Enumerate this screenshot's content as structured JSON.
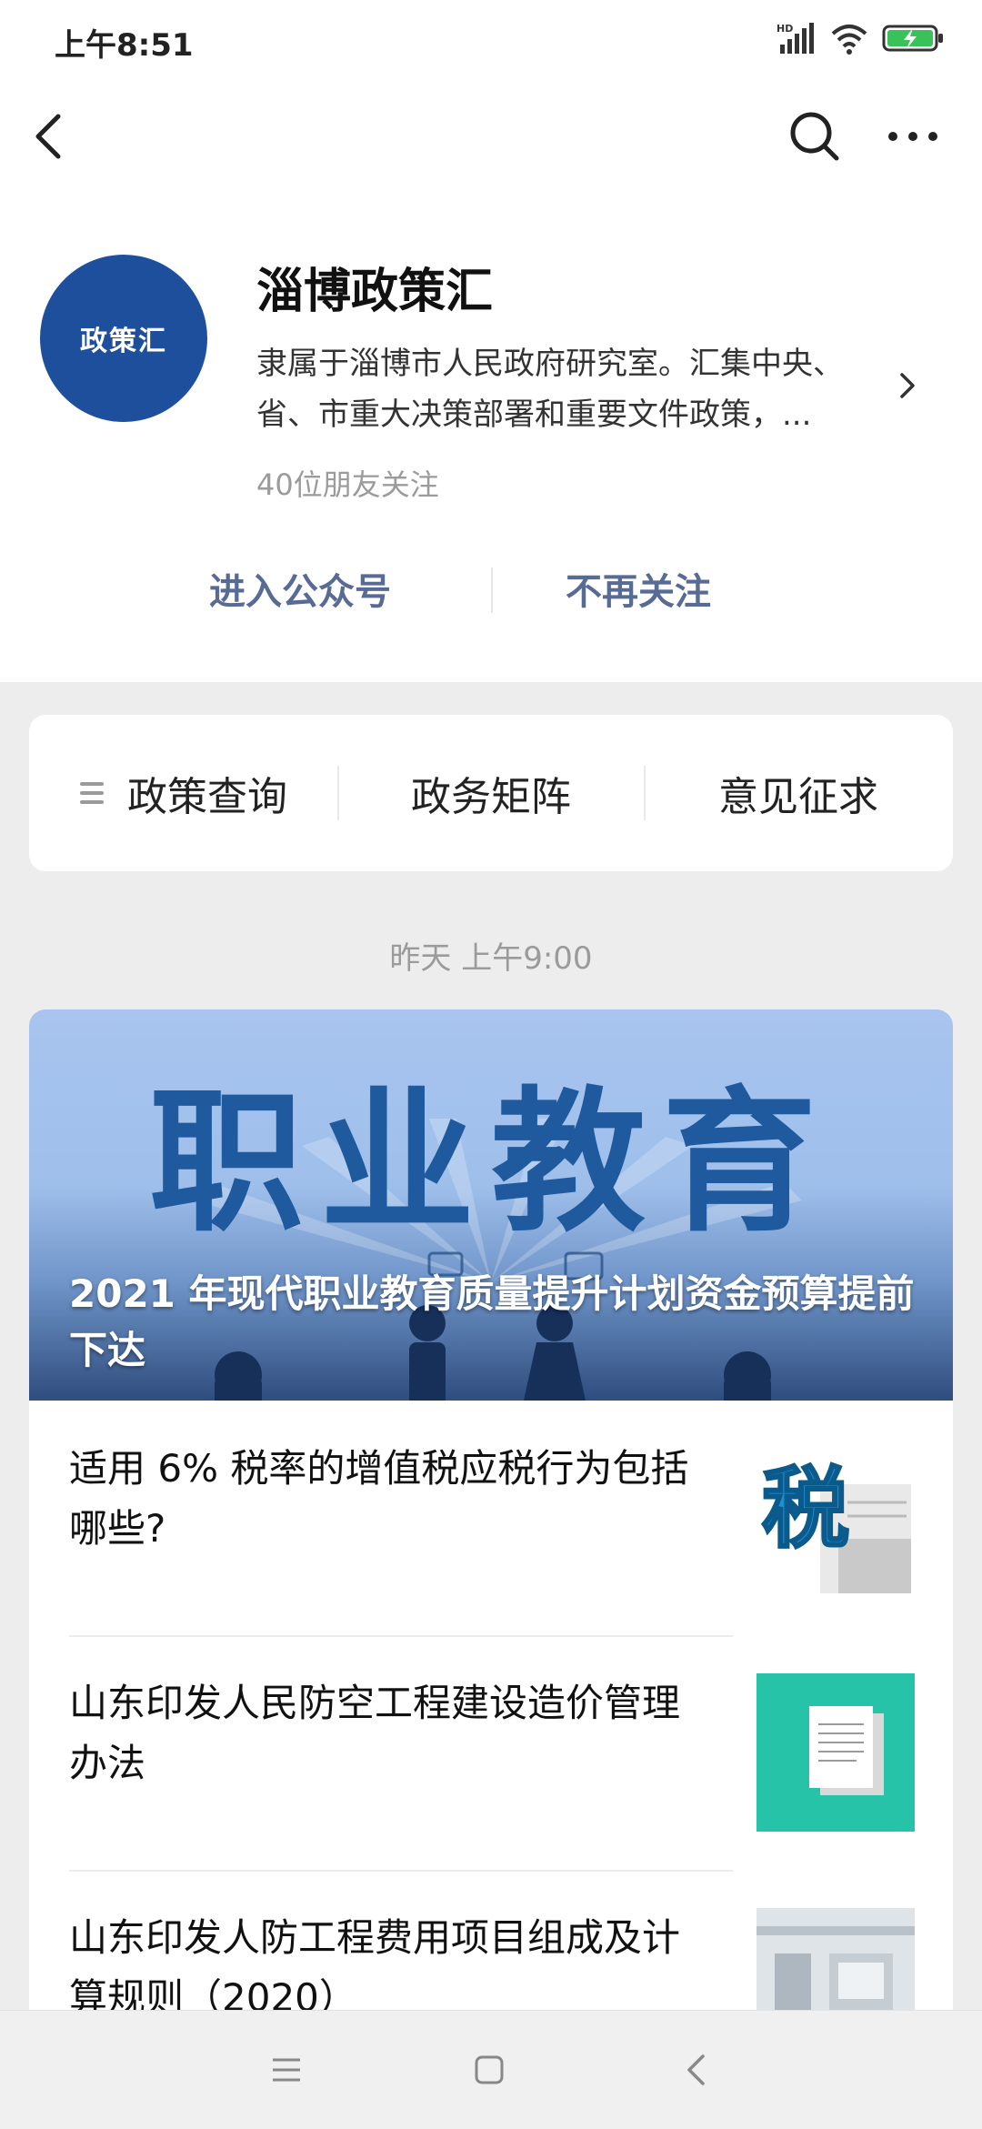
{
  "status_bar": {
    "time": "上午8:51",
    "icons": [
      "hd-signal-icon",
      "wifi-icon",
      "battery-charging-icon"
    ]
  },
  "nav": {
    "back_icon": "back-chevron-icon",
    "search_icon": "search-icon",
    "more_icon": "more-dots-icon"
  },
  "profile": {
    "avatar_text": "政策汇",
    "name": "淄博政策汇",
    "description": "隶属于淄博市人民政府研究室。汇集中央、省、市重大决策部署和重要文件政策，...",
    "followers": "40位朋友关注",
    "enter_label": "进入公众号",
    "unfollow_label": "不再关注"
  },
  "menu": {
    "items": [
      {
        "label": "政策查询"
      },
      {
        "label": "政务矩阵"
      },
      {
        "label": "意见征求"
      }
    ]
  },
  "timestamp": "昨天 上午9:00",
  "cover_article": {
    "banner_text": "职业教育",
    "title": "2021 年现代职业教育质量提升计划资金预算提前下达"
  },
  "articles": [
    {
      "title": "适用 6% 税率的增值税应税行为包括哪些?",
      "thumb_text": "税"
    },
    {
      "title": "山东印发人民防空工程建设造价管理办法"
    },
    {
      "title": "山东印发人防工程费用项目组成及计算规则（2020）"
    }
  ],
  "colors": {
    "link_blue": "#576b95",
    "avatar_blue": "#1d4f9c",
    "teal_thumb": "#27c3a8",
    "background": "#ededed"
  }
}
